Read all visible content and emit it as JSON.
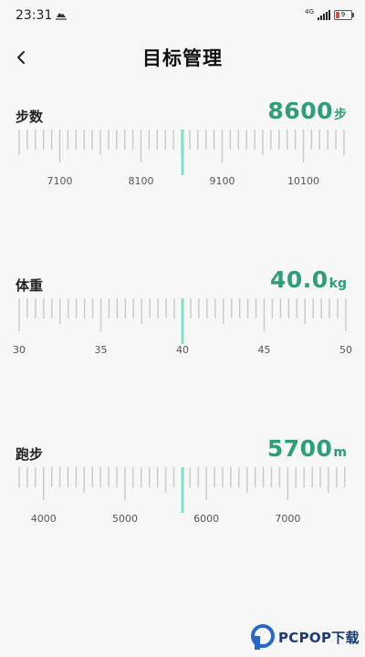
{
  "status": {
    "time": "23:31",
    "network": "4G",
    "battery": "9"
  },
  "header": {
    "title": "目标管理",
    "back_icon": "chevron-left-icon"
  },
  "goals": [
    {
      "label": "步数",
      "value": "8600",
      "unit": "步",
      "scale": {
        "labels": [
          "7100",
          "8100",
          "9100",
          "10100"
        ]
      }
    },
    {
      "label": "体重",
      "value": "40.0",
      "unit": "kg",
      "scale": {
        "labels": [
          "30",
          "35",
          "40",
          "45",
          "50"
        ]
      }
    },
    {
      "label": "跑步",
      "value": "5700",
      "unit": "m",
      "scale": {
        "labels": [
          "4000",
          "5000",
          "6000",
          "7000"
        ]
      }
    }
  ],
  "colors": {
    "accent": "#2c9e78",
    "indicator": "#7fe0c8",
    "tick": "#c8c8c8"
  },
  "watermark": {
    "text": "PCPOP下载"
  }
}
